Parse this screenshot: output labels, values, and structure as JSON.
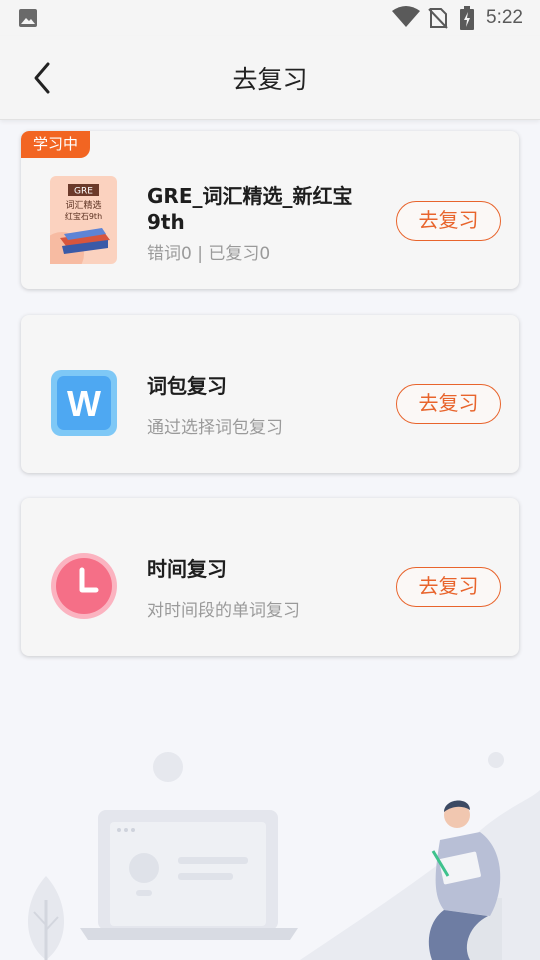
{
  "status_bar": {
    "time": "5:22"
  },
  "header": {
    "title": "去复习"
  },
  "cards": [
    {
      "badge": "学习中",
      "book_cover": {
        "line1": "GRE",
        "line2": "词汇精选",
        "line3": "红宝石9th"
      },
      "title": "GRE_词汇精选_新红宝9th",
      "subtitle": "错词0 | 已复习0",
      "button": "去复习"
    },
    {
      "icon_letter": "W",
      "title": "词包复习",
      "subtitle": "通过选择词包复习",
      "button": "去复习"
    },
    {
      "title": "时间复习",
      "subtitle": "对时间段的单词复习",
      "button": "去复习"
    }
  ],
  "colors": {
    "accent": "#e8642c",
    "badge": "#f26522"
  }
}
